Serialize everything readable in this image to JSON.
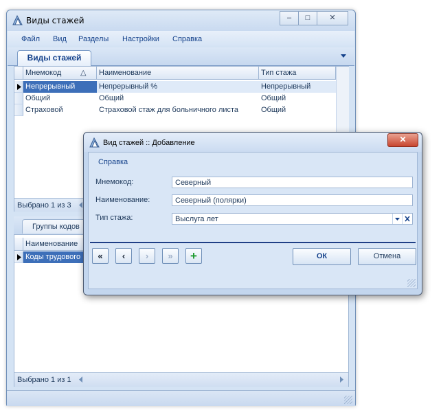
{
  "main_window": {
    "title": "Виды стажей",
    "controls": {
      "minimize": "–",
      "maximize": "□",
      "close": "✕"
    },
    "menu": [
      "Файл",
      "Вид",
      "Разделы",
      "Настройки",
      "Справка"
    ],
    "tab_label": "Виды стажей",
    "grid": {
      "columns": [
        "Мнемокод",
        "Наименование",
        "Тип стажа"
      ],
      "sort_indicator": "△",
      "rows": [
        [
          "Непрерывный",
          "Непрерывный %",
          "Непрерывный"
        ],
        [
          "Общий",
          "Общий",
          "Общий"
        ],
        [
          "Страховой",
          "Страховой стаж для больничного листа",
          "Общий"
        ]
      ],
      "status": "Выбрано 1 из 3"
    },
    "lower_tab_label": "Группы кодов",
    "lower_grid": {
      "column": "Наименование",
      "rows": [
        "Коды трудового"
      ],
      "status": "Выбрано 1 из 1"
    }
  },
  "dialog": {
    "title": "Вид стажей :: Добавление",
    "close_label": "✕",
    "help_link": "Справка",
    "fields": [
      {
        "label": "Мнемокод:",
        "value": "Северный"
      },
      {
        "label": "Наименование:",
        "value": "Северный (полярки)"
      },
      {
        "label": "Тип стажа:",
        "value": "Выслуга лет"
      }
    ],
    "nav": {
      "first": "«",
      "prev": "‹",
      "next": "›",
      "last": "»",
      "add": "+"
    },
    "ok_label": "ОК",
    "cancel_label": "Отмена"
  },
  "colors": {
    "accent": "#15428b",
    "selection": "#3d6fb9",
    "close": "#c8452f"
  }
}
